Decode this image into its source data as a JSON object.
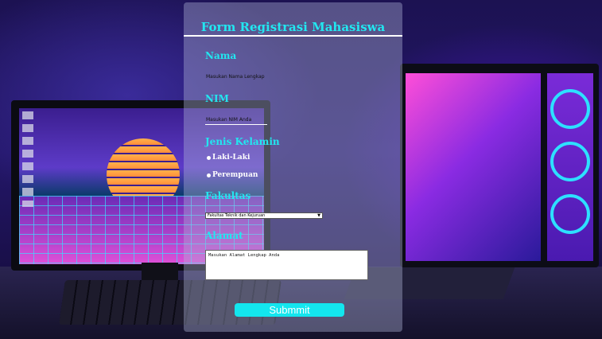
{
  "form": {
    "title": "Form Registrasi Mahasiswa",
    "nama": {
      "label": "Nama",
      "placeholder": "Masukan Nama Lengkap"
    },
    "nim": {
      "label": "NIM",
      "placeholder": "Masukan NIM Anda"
    },
    "gender": {
      "label": "Jenis Kelamin",
      "options": [
        "Laki-Laki",
        "Perempuan"
      ]
    },
    "fakultas": {
      "label": "Fakultas",
      "selected": "Fakultas Teknik dan Kejuruan"
    },
    "alamat": {
      "label": "Alamat",
      "placeholder": "Masukan Alamat Lengkap Anda"
    },
    "submit_label": "Submmit"
  },
  "colors": {
    "accent": "#22e7f0",
    "button": "#13e6ee"
  }
}
